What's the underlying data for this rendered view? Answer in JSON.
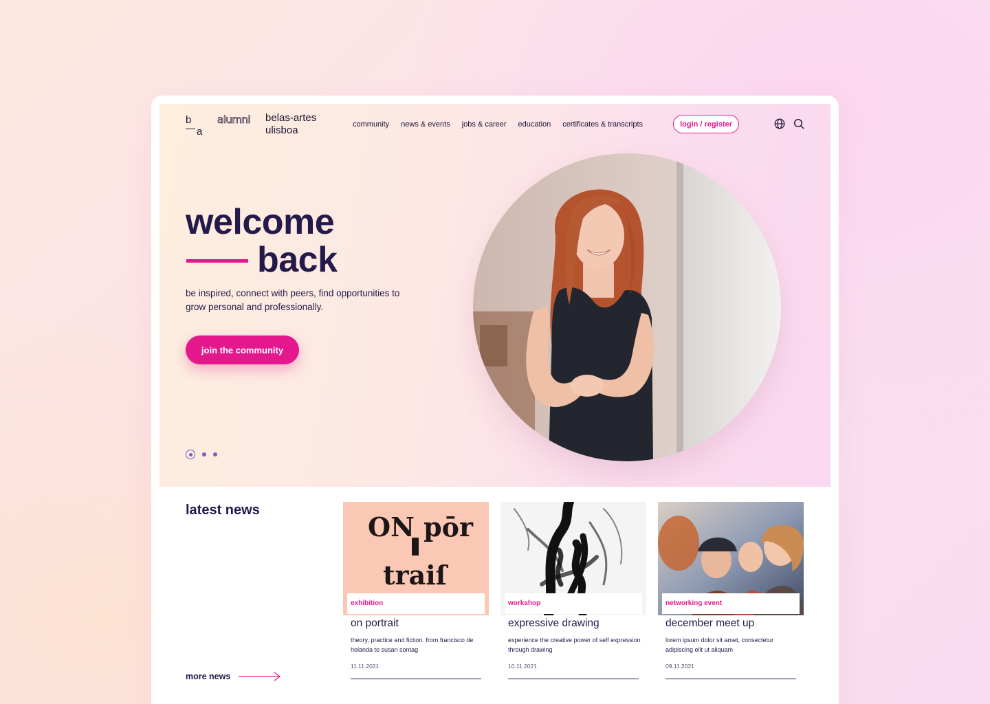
{
  "header": {
    "logo_b": "b",
    "logo_a": "a",
    "alumni": "alumni",
    "brand_line1": "belas-artes",
    "brand_line2": "ulisboa",
    "nav": [
      "community",
      "news & events",
      "jobs & career",
      "education",
      "certificates & transcripts"
    ],
    "login_label": "login / register",
    "icons": [
      "globe-icon",
      "search-icon"
    ]
  },
  "hero": {
    "title_line1": "welcome",
    "title_line2": "back",
    "subtitle": "be inspired, connect with peers, find opportunities to grow personal and professionally.",
    "cta_label": "join the community",
    "slides_total": 3,
    "slide_active": 1
  },
  "news": {
    "title": "latest news",
    "more_label": "more news",
    "cards": [
      {
        "tag": "exhibition",
        "title": "on portrait",
        "desc": "theory, practice and fiction. from francisco de holanda to susan sontag",
        "date": "11.11.2021",
        "art_line1": "ON pōr",
        "art_line2": "traiſ"
      },
      {
        "tag": "workshop",
        "title": "expressive drawing",
        "desc": "experience the creative power of self expression through drawing",
        "date": "10.11.2021"
      },
      {
        "tag": "networking event",
        "title": "december meet up",
        "desc": "lorem ipsum dolor sit amet, consectetur adipiscing elit ut aliquam",
        "date": "09.11.2021"
      }
    ]
  },
  "colors": {
    "accent": "#e5178c",
    "ink": "#23194a",
    "dots": "#7f5bc8"
  }
}
